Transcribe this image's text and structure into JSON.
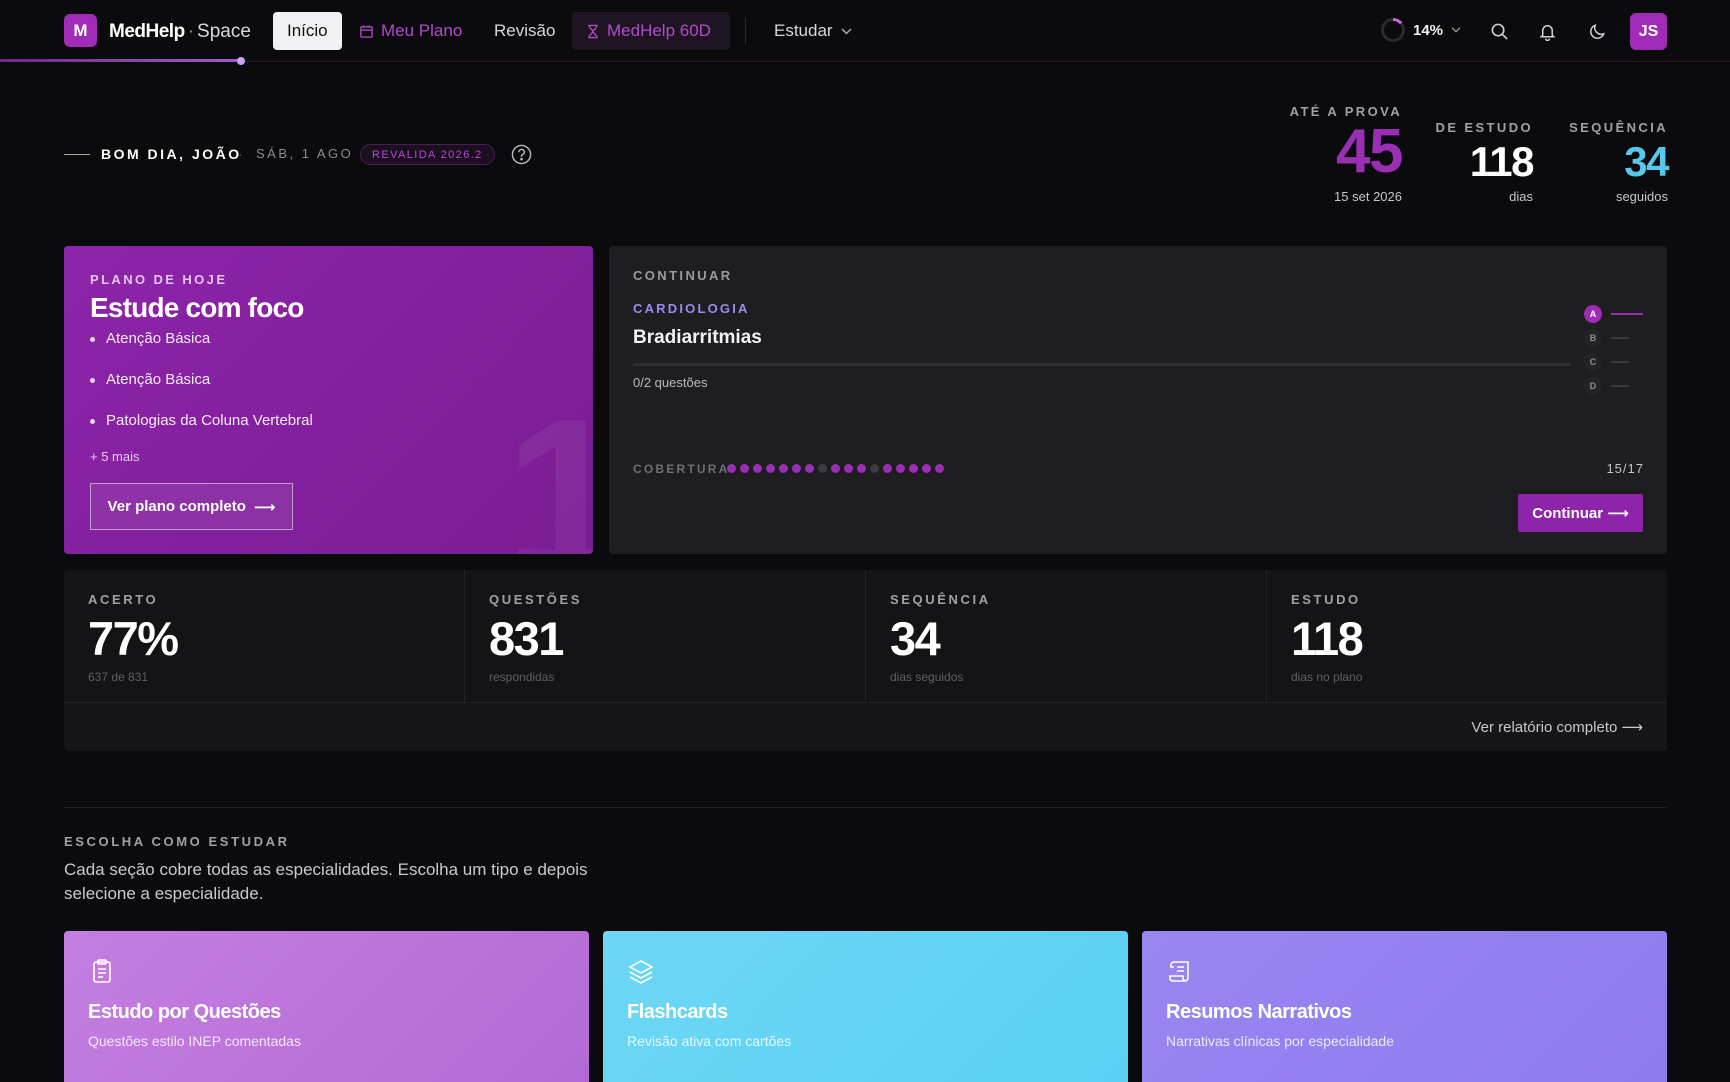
{
  "header": {
    "logo_letter": "M",
    "brand_main": "MedHelp",
    "brand_sep": "·",
    "brand_sub": "Space",
    "nav": {
      "inicio": "Início",
      "meu_plano": "Meu Plano",
      "revisao": "Revisão",
      "medhelp60d": "MedHelp 60D",
      "estudar": "Estudar"
    },
    "progress_pct_label": "14%",
    "progress_fraction": 0.14,
    "avatar_initials": "JS",
    "accent_color": "#a02bb6"
  },
  "greeting": {
    "name": "BOM DIA, JOÃO",
    "separator": "·",
    "date": "SÁB, 1 AGO",
    "badge": "REVALIDA 2026.2"
  },
  "kpis": {
    "prova": {
      "label": "ATÉ A PROVA",
      "value": "45",
      "sub": "15 set 2026"
    },
    "estudo": {
      "label": "DE ESTUDO",
      "value": "118",
      "sub": "dias"
    },
    "sequencia": {
      "label": "SEQUÊNCIA",
      "value": "34",
      "sub": "seguidos"
    }
  },
  "plan": {
    "label": "PLANO DE HOJE",
    "title": "Estude com foco",
    "items": [
      "Atenção Básica",
      "Atenção Básica",
      "Patologias da Coluna Vertebral"
    ],
    "more": "+ 5 mais",
    "button": "Ver plano completo",
    "button_arrow": "⟶",
    "watermark": "1"
  },
  "continue": {
    "label": "CONTINUAR",
    "topic": "CARDIOLOGIA",
    "title": "Bradiarritmias",
    "questions": "0/2 questões",
    "options": [
      "A",
      "B",
      "C",
      "D"
    ],
    "coverage_label": "COBERTURA",
    "coverage_dots": [
      1,
      1,
      1,
      1,
      1,
      1,
      1,
      0,
      1,
      1,
      1,
      0,
      1,
      1,
      1,
      1,
      1
    ],
    "coverage_count": "15/17",
    "button": "Continuar ⟶"
  },
  "stats": [
    {
      "label": "ACERTO",
      "value": "77%",
      "sub": "637 de 831"
    },
    {
      "label": "QUESTÕES",
      "value": "831",
      "sub": "respondidas"
    },
    {
      "label": "SEQUÊNCIA",
      "value": "34",
      "sub": "dias seguidos"
    },
    {
      "label": "ESTUDO",
      "value": "118",
      "sub": "dias no plano"
    }
  ],
  "report_link": "Ver relatório completo ⟶",
  "choose": {
    "label": "ESCOLHA COMO ESTUDAR",
    "description": "Cada seção cobre todas as especialidades. Escolha um tipo e depois selecione a especialidade."
  },
  "modes": [
    {
      "title": "Estudo por Questões",
      "sub": "Questões estilo INEP comentadas",
      "icon": "clipboard-icon"
    },
    {
      "title": "Flashcards",
      "sub": "Revisão ativa com cartões",
      "icon": "layers-icon"
    },
    {
      "title": "Resumos Narrativos",
      "sub": "Narrativas clínicas por especialidade",
      "icon": "scroll-icon"
    }
  ]
}
